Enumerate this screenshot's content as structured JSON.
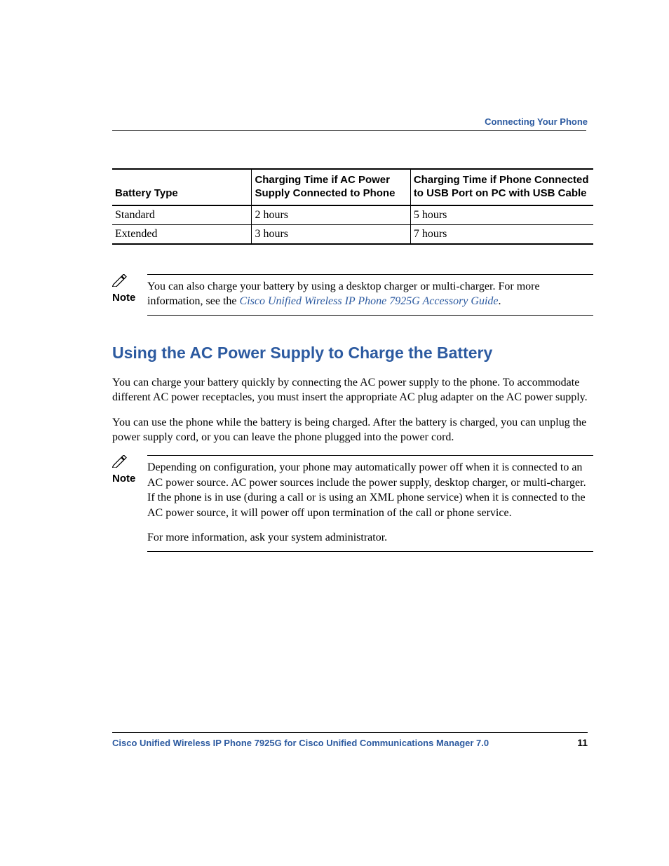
{
  "running_head": "Connecting Your Phone",
  "table": {
    "headers": {
      "c1": "Battery Type",
      "c2": "Charging Time if AC Power Supply Connected to Phone",
      "c3": "Charging Time if Phone Connected to USB Port on PC with USB Cable"
    },
    "rows": [
      {
        "c1": "Standard",
        "c2": "2 hours",
        "c3": "5 hours"
      },
      {
        "c1": "Extended",
        "c2": "3 hours",
        "c3": "7 hours"
      }
    ]
  },
  "note1": {
    "label": "Note",
    "text_before_link": "You can also charge your battery by using a desktop charger or multi-charger. For more information, see the ",
    "link_text": "Cisco Unified Wireless IP Phone 7925G Accessory Guide",
    "text_after_link": "."
  },
  "section_heading": "Using the AC Power Supply to Charge the Battery",
  "para1": "You can charge your battery quickly by connecting the AC power supply to the phone. To accommodate different AC power receptacles, you must insert the appropriate AC plug adapter on the AC power supply.",
  "para2": "You can use the phone while the battery is being charged. After the battery is charged, you can unplug the power supply cord, or you can leave the phone plugged into the power cord.",
  "note2": {
    "label": "Note",
    "p1": "Depending on configuration, your phone may automatically power off when it is connected to an AC power source. AC power sources include the power supply, desktop charger, or multi-charger. If the phone is in use (during a call or is using an XML phone service) when it is connected to the AC power source, it will power off upon termination of the call or phone service.",
    "p2": "For more information, ask your system administrator."
  },
  "footer": {
    "title": "Cisco Unified Wireless IP Phone 7925G for Cisco Unified Communications Manager 7.0",
    "page": "11"
  },
  "chart_data": {
    "type": "table",
    "title": "Battery charging times",
    "columns": [
      "Battery Type",
      "Charging Time if AC Power Supply Connected to Phone",
      "Charging Time if Phone Connected to USB Port on PC with USB Cable"
    ],
    "rows": [
      [
        "Standard",
        "2 hours",
        "5 hours"
      ],
      [
        "Extended",
        "3 hours",
        "7 hours"
      ]
    ]
  }
}
